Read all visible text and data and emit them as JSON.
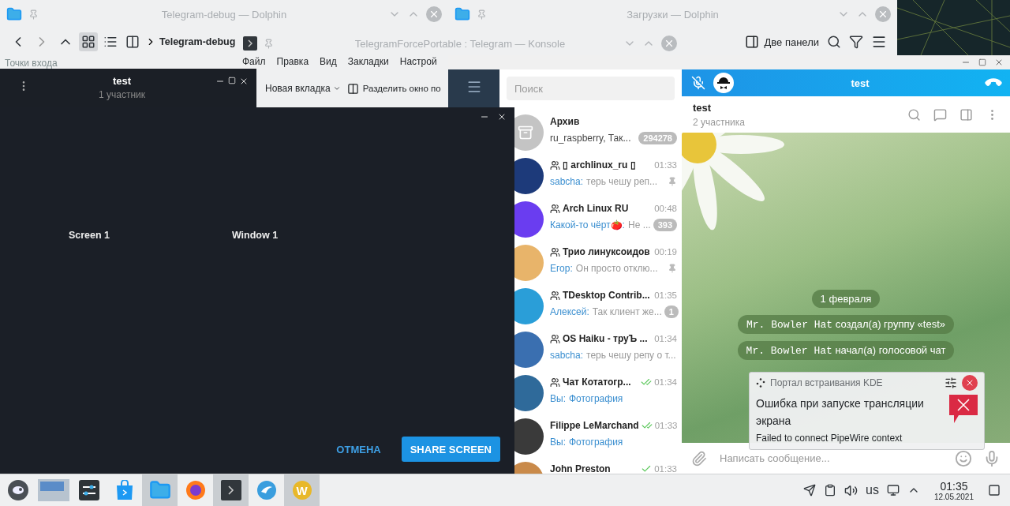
{
  "dolphin_left": {
    "title": "Telegram-debug — Dolphin",
    "breadcrumb": "Telegram-debug",
    "places_label": "Точки входа"
  },
  "dolphin_right": {
    "title": "Загрузки — Dolphin",
    "split_button": "Две панели"
  },
  "konsole": {
    "title": "TelegramForcePortable : Telegram — Konsole",
    "menu": [
      "Файл",
      "Правка",
      "Вид",
      "Закладки",
      "Настрой"
    ],
    "new_tab": "Новая вкладка",
    "split": "Разделить окно по"
  },
  "telegram": {
    "search_placeholder": "Поиск",
    "chats": [
      {
        "kind": "archive",
        "name": "Архив",
        "preview": "ru_raspberry, Так...",
        "badge": "294278",
        "group": false,
        "pinned": false,
        "media": false,
        "sent": false,
        "read": false,
        "color": "#c4c4c4"
      },
      {
        "kind": "chat",
        "name": "▯ archlinux_ru ▯",
        "time": "01:33",
        "sender": "sabcha:",
        "preview": "терь чешу реп...",
        "group": true,
        "pinned": true,
        "media": false,
        "sent": false,
        "read": false,
        "color": "#1d3a7a"
      },
      {
        "kind": "chat",
        "name": "Arch Linux RU",
        "time": "00:48",
        "sender": "Какой-то чёрт🍅:",
        "preview": "Не ...",
        "badge": "393",
        "group": true,
        "pinned": false,
        "media": false,
        "sent": false,
        "read": false,
        "color": "#6a3df0"
      },
      {
        "kind": "chat",
        "name": "Трио линуксоидов",
        "time": "00:19",
        "sender": "Егор:",
        "preview": "Он просто отклю...",
        "group": true,
        "pinned": true,
        "media": false,
        "sent": false,
        "read": false,
        "color": "#e8b46a"
      },
      {
        "kind": "chat",
        "name": "TDesktop Contrib...",
        "time": "01:35",
        "sender": "Алексей:",
        "preview": "Так клиент же...",
        "badge": "1",
        "group": true,
        "pinned": false,
        "media": false,
        "sent": false,
        "read": false,
        "color": "#2a9ed8"
      },
      {
        "kind": "chat",
        "name": "OS Haiku - труЪ ...",
        "time": "01:34",
        "sender": "sabcha:",
        "preview": "терь чешу репу о т...",
        "group": true,
        "pinned": false,
        "media": false,
        "sent": false,
        "read": false,
        "color": "#3a6fb0"
      },
      {
        "kind": "chat",
        "name": "Чат Котатогр...",
        "time": "01:34",
        "sender": "Вы:",
        "preview": "Фотография",
        "group": true,
        "pinned": false,
        "media": true,
        "sent": true,
        "read": true,
        "color": "#2f6a9a"
      },
      {
        "kind": "chat",
        "name": "Filippe LeMarchand",
        "time": "01:33",
        "sender": "Вы:",
        "preview": "Фотография",
        "group": false,
        "pinned": false,
        "media": true,
        "sent": true,
        "read": true,
        "color": "#3a3a3a"
      },
      {
        "kind": "chat",
        "name": "John Preston",
        "time": "01:33",
        "group": false,
        "pinned": false,
        "media": false,
        "sent": true,
        "read": false,
        "color": "#c98a4a"
      }
    ],
    "call_title": "test",
    "chat_title": "test",
    "chat_subtitle": "2 участника",
    "service_messages": [
      {
        "kind": "date",
        "text": "1 февраля"
      },
      {
        "kind": "action",
        "actor": "Mr. Bowler Hat",
        "text": "создал(а) группу «test»"
      },
      {
        "kind": "action",
        "actor": "Mr. Bowler Hat",
        "text": "начал(а) голосовой чат"
      }
    ],
    "compose_placeholder": "Написать сообщение..."
  },
  "voice_chat": {
    "title": "test",
    "subtitle": "1 участник"
  },
  "share_dialog": {
    "sources": [
      "Screen 1",
      "Window 1"
    ],
    "cancel": "ОТМЕНА",
    "confirm": "SHARE SCREEN"
  },
  "notification": {
    "app": "Портал встраивания KDE",
    "title": "Ошибка при запуске трансляции экрана",
    "body": "Failed to connect PipeWire context"
  },
  "taskbar": {
    "tasks": [
      {
        "kind": "menu",
        "active": false
      },
      {
        "kind": "pager",
        "active": false
      },
      {
        "kind": "settings",
        "active": false
      },
      {
        "kind": "store",
        "active": false
      },
      {
        "kind": "files",
        "active": true
      },
      {
        "kind": "browser",
        "active": false
      },
      {
        "kind": "terminal",
        "active": true
      },
      {
        "kind": "messenger",
        "active": false
      },
      {
        "kind": "wine",
        "active": true,
        "logo_text": "W"
      }
    ],
    "layout": "us",
    "time": "01:35",
    "date": "12.05.2021"
  }
}
